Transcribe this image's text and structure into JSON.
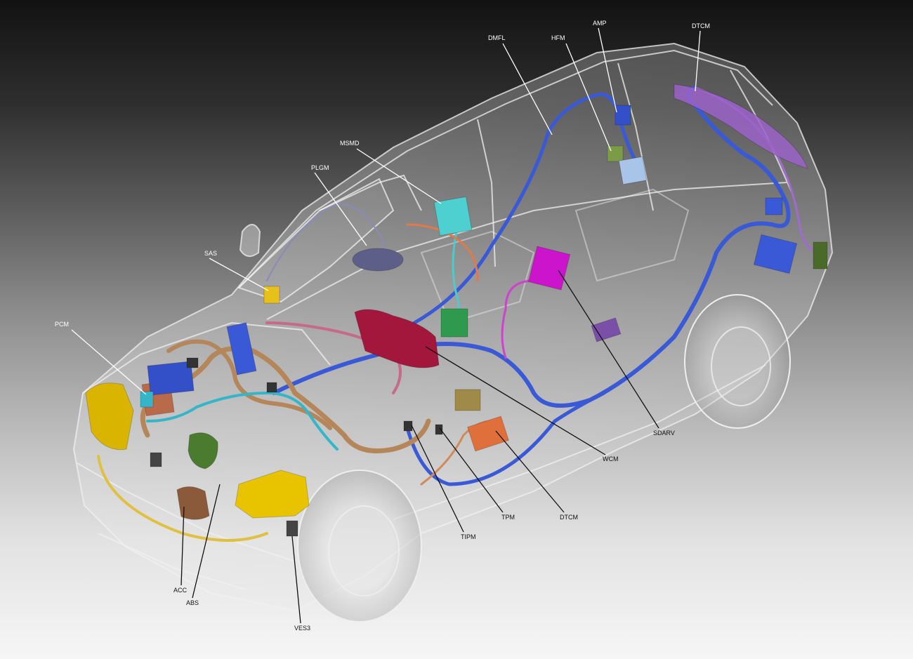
{
  "labels": {
    "dmfl": "DMFL",
    "hfm": "HFM",
    "amp": "AMP",
    "dtcm_rear": "DTCM",
    "msmd": "MSMD",
    "plgm": "PLGM",
    "sas": "SAS",
    "pcm": "PCM",
    "sdarv": "SDARV",
    "wcm": "WCM",
    "dtcm_front": "DTCM",
    "tpm": "TPM",
    "tipm": "TIPM",
    "acc": "ACC",
    "abs": "ABS",
    "ves3": "VES3"
  },
  "module_colors": {
    "pcm": "#d9b400",
    "headlamp": "#e8c400",
    "sas": "#e6c11a",
    "plgm": "#5d5f88",
    "msmd": "#4fd0d0",
    "sdarv": "#cc14cc",
    "wcm": "#a3173d",
    "dtcm_front": "#e0703b",
    "tipm": "#b86a4a",
    "amp": "#3450c8",
    "hfm": "#7c9b49",
    "dtcm_rear": "#9b63c9",
    "acc": "#8a5a3a",
    "abs": "#4b7b2f",
    "harness_main": "#3a59d6",
    "harness_engine": "#b4865a",
    "harness_cyan": "#34b6c8"
  }
}
